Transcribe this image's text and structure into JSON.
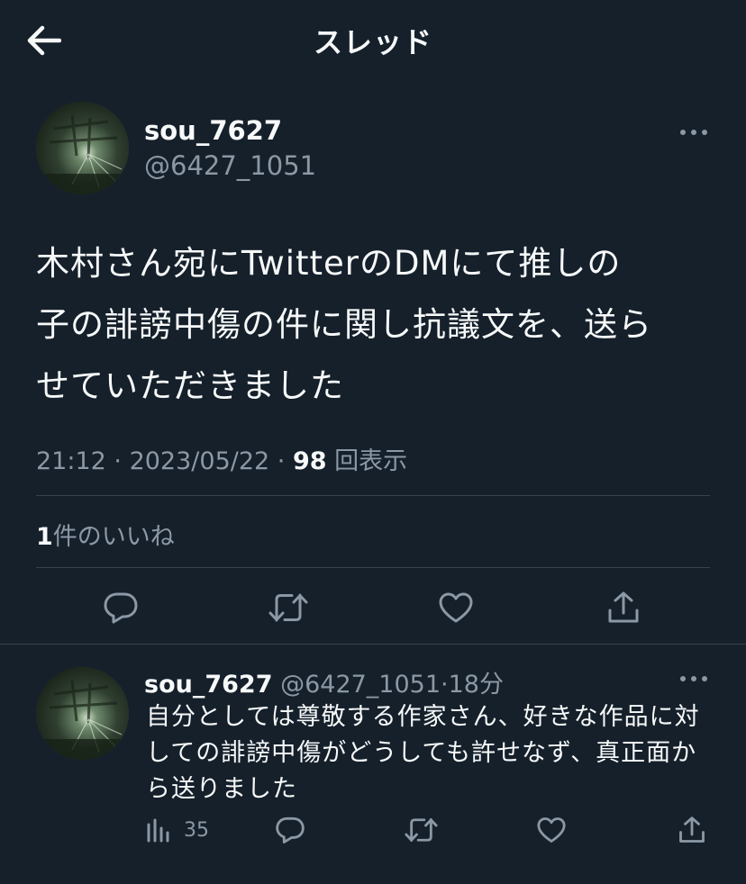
{
  "header": {
    "title": "スレッド"
  },
  "tweet": {
    "display_name": "sou_7627",
    "handle": "@6427_1051",
    "text_lines": [
      "木村さん宛にTwitterのDMにて推しの",
      "子の誹謗中傷の件に関し抗議文を、送ら",
      "せていただきました"
    ],
    "time": "21:12",
    "date": "2023/05/22",
    "views_count": "98",
    "views_label": "回表示",
    "likes_count": "1",
    "likes_label": "件のいいね"
  },
  "reply": {
    "display_name": "sou_7627",
    "handle": "@6427_1051",
    "time_ago": "18分",
    "text_lines": [
      "自分としては尊敬する作家さん、好きな作品に対",
      "しての誹謗中傷がどうしても許せなず、真正面か",
      "ら送りました"
    ],
    "views_count": "35"
  },
  "icons": {
    "back": "arrow-left-icon",
    "more": "more-dots-icon",
    "reply": "reply-bubble-icon",
    "retweet": "retweet-icon",
    "like": "heart-icon",
    "share": "share-icon",
    "views": "bar-chart-icon"
  },
  "colors": {
    "background": "#15202b",
    "text": "#f7f9f9",
    "secondary": "#8b98a5",
    "divider": "#38444d"
  }
}
